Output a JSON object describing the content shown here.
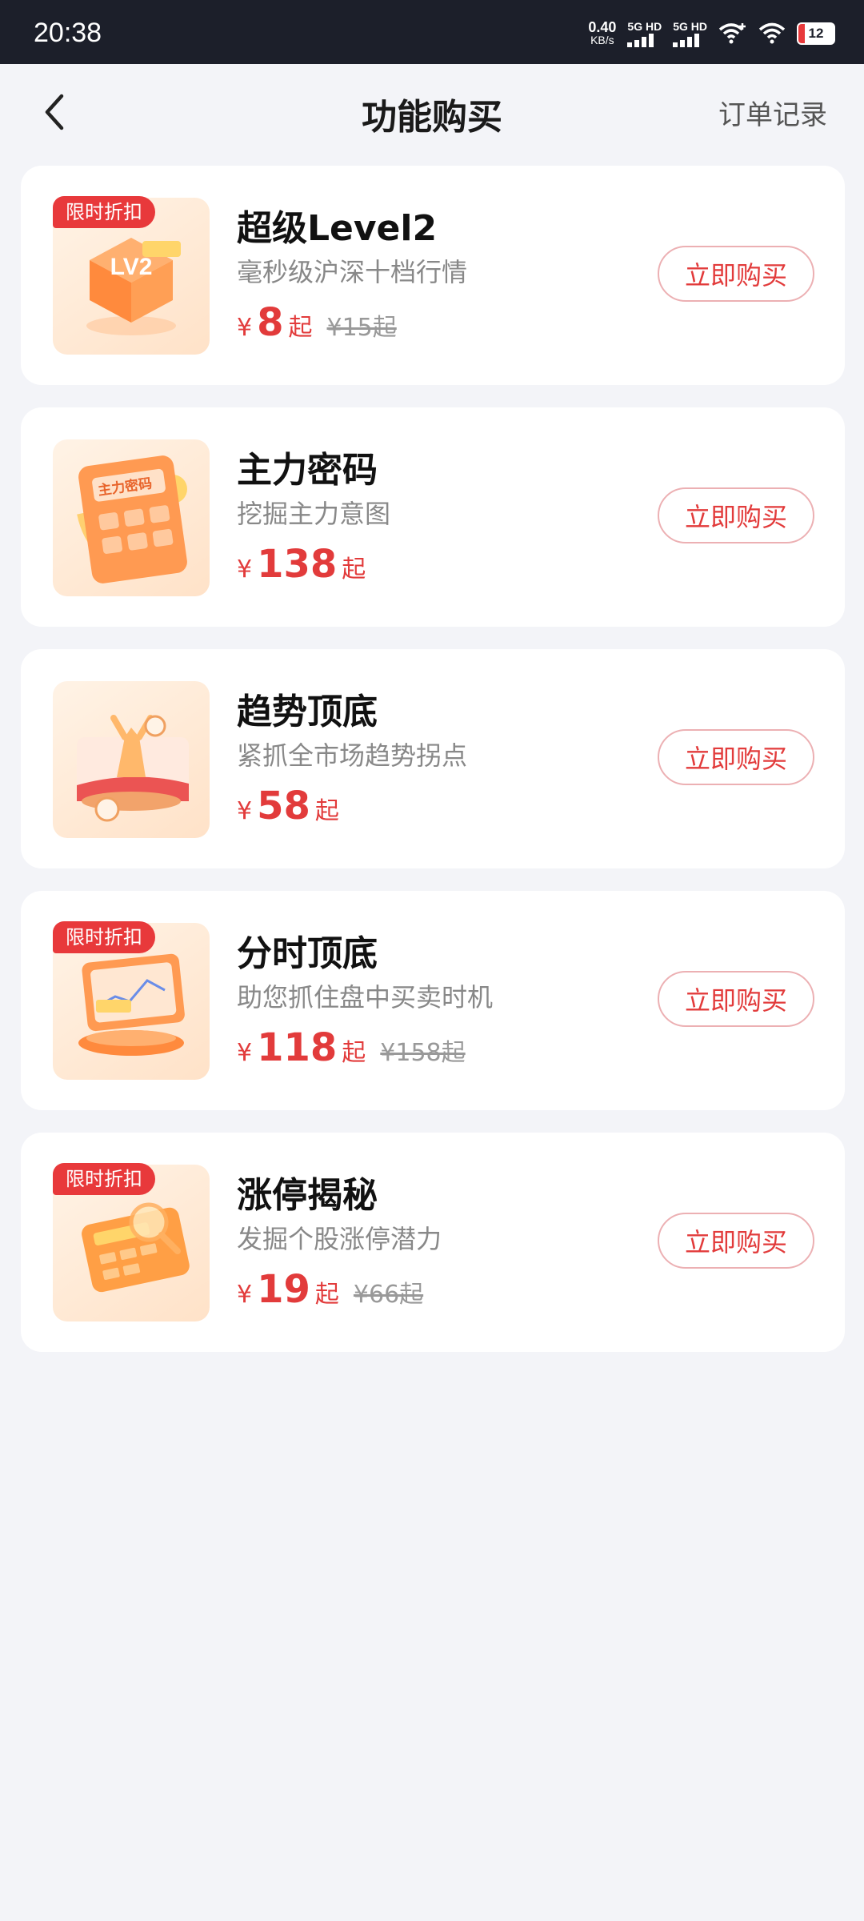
{
  "status_bar": {
    "time": "20:38",
    "net_speed": "0.40",
    "net_unit": "KB/s",
    "sim1": "5G HD",
    "sim2": "5G HD",
    "battery": "12"
  },
  "header": {
    "title": "功能购买",
    "right_link": "订单记录"
  },
  "colors": {
    "accent": "#e23b3b",
    "badge": "#e8393b",
    "background": "#f3f4f8"
  },
  "products": [
    {
      "badge": "限时折扣",
      "name": "超级Level2",
      "desc": "毫秒级沪深十档行情",
      "currency": "¥",
      "price": "8",
      "unit": "起",
      "orig": "¥15起",
      "button": "立即购买",
      "icon": "level2-cube-icon"
    },
    {
      "badge": "",
      "name": "主力密码",
      "desc": "挖掘主力意图",
      "currency": "¥",
      "price": "138",
      "unit": "起",
      "orig": "",
      "button": "立即购买",
      "icon": "calculator-icon"
    },
    {
      "badge": "",
      "name": "趋势顶底",
      "desc": "紧抓全市场趋势拐点",
      "currency": "¥",
      "price": "58",
      "unit": "起",
      "orig": "",
      "button": "立即购买",
      "icon": "trend-bull-icon"
    },
    {
      "badge": "限时折扣",
      "name": "分时顶底",
      "desc": "助您抓住盘中买卖时机",
      "currency": "¥",
      "price": "118",
      "unit": "起",
      "orig": "¥158起",
      "button": "立即购买",
      "icon": "chart-monitor-icon"
    },
    {
      "badge": "限时折扣",
      "name": "涨停揭秘",
      "desc": "发掘个股涨停潜力",
      "currency": "¥",
      "price": "19",
      "unit": "起",
      "orig": "¥66起",
      "button": "立即购买",
      "icon": "card-magnifier-icon"
    }
  ]
}
